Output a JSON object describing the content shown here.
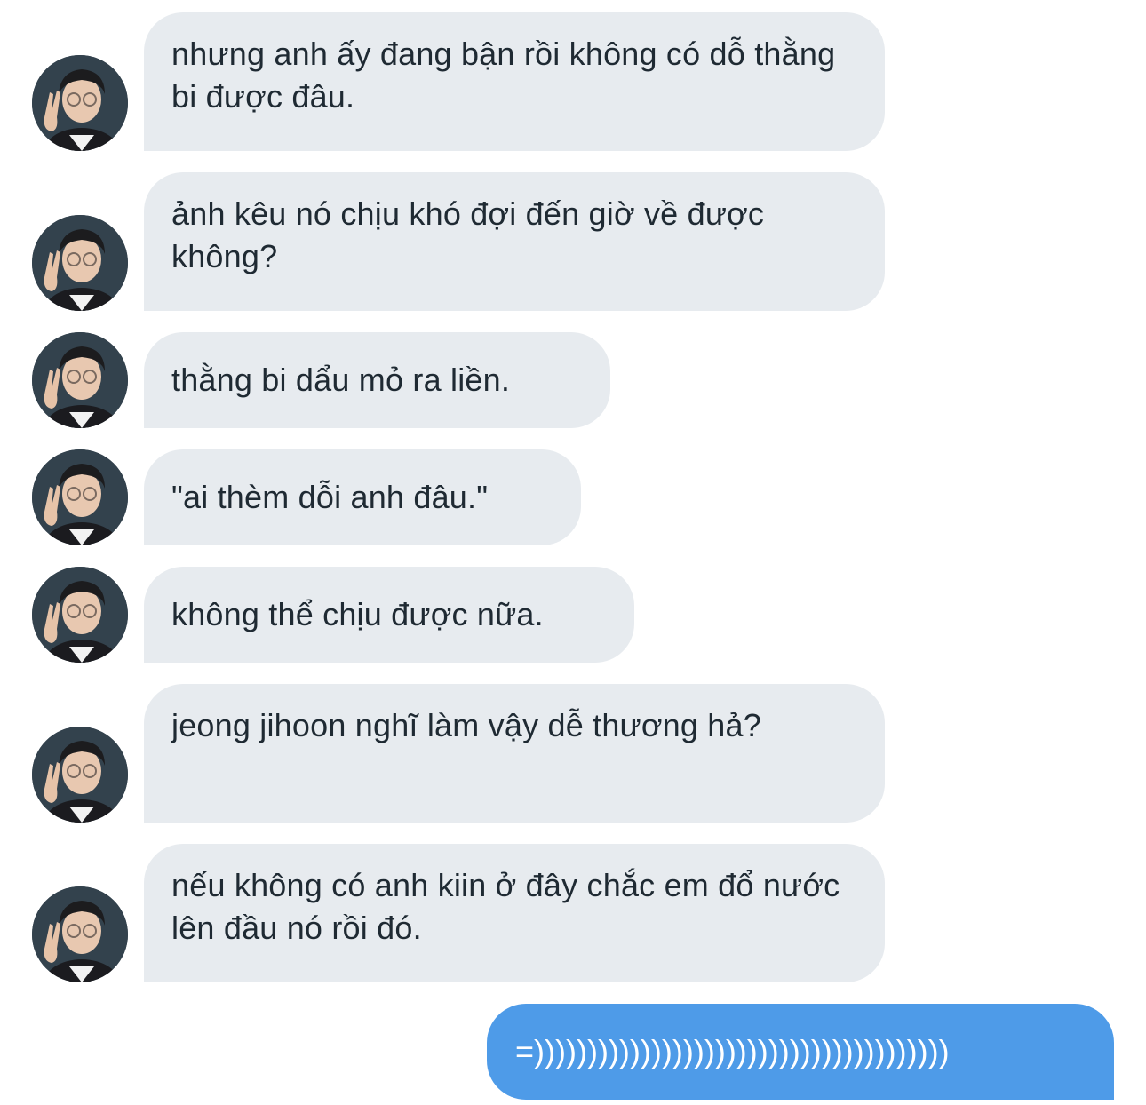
{
  "conversation": {
    "incoming": [
      {
        "text": "nhưng anh ấy đang bận rồi không có dỗ thằng bi được đâu."
      },
      {
        "text": "ảnh kêu nó chịu khó đợi đến giờ về được không?"
      },
      {
        "text": "thằng bi dẩu mỏ ra liền."
      },
      {
        "text": "\"ai thèm dỗi anh đâu.\""
      },
      {
        "text": "không thể chịu được nữa."
      },
      {
        "text": "jeong jihoon nghĩ làm vậy dễ thương hả?"
      },
      {
        "text": "nếu không có anh kiin ở đây chắc em đổ nước lên đầu nó rồi đó."
      }
    ],
    "outgoing": [
      {
        "text": "=)))))))))))))))))))))))))))))))))))))))"
      }
    ]
  },
  "icons": {
    "avatar": "profile-avatar-peace-sign"
  },
  "colors": {
    "incoming_bubble": "#e7ebef",
    "incoming_text": "#1f2a33",
    "outgoing_bubble": "#4e9be8",
    "outgoing_text": "#ffffff"
  }
}
